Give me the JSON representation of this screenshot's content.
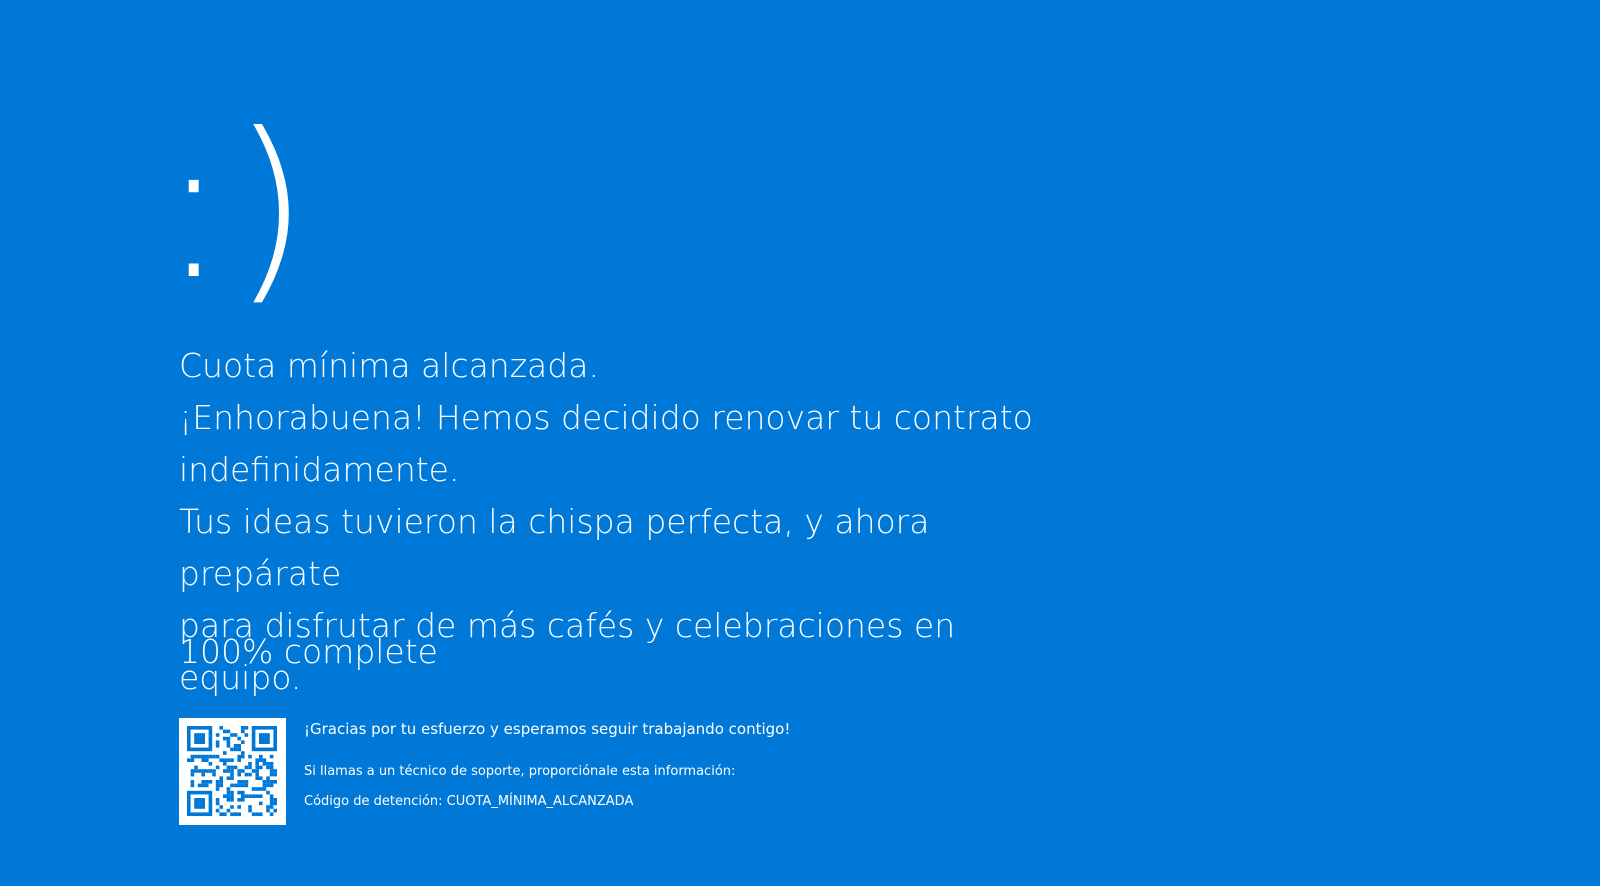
{
  "screen": {
    "background_color": "#0078d7",
    "text_color": "#ffffff",
    "face": ":)",
    "message_lines": [
      "Cuota mínima alcanzada.",
      "¡Enhorabuena! Hemos decidido renovar tu contrato",
      "indefinidamente.",
      "Tus ideas tuvieron la chispa perfecta, y ahora prepárate",
      "para disfrutar de más cafés y celebraciones en equipo."
    ],
    "progress_percent": 100,
    "progress_text": "100% complete",
    "qr_icon": "qr-code-icon",
    "thanks_text": "¡Gracias por tu esfuerzo y esperamos seguir trabajando contigo!",
    "support_text": "Si llamas a un técnico de soporte, proporciónale esta información:",
    "stop_code_text": "Código de detención: CUOTA_MÍNIMA_ALCANZADA"
  }
}
